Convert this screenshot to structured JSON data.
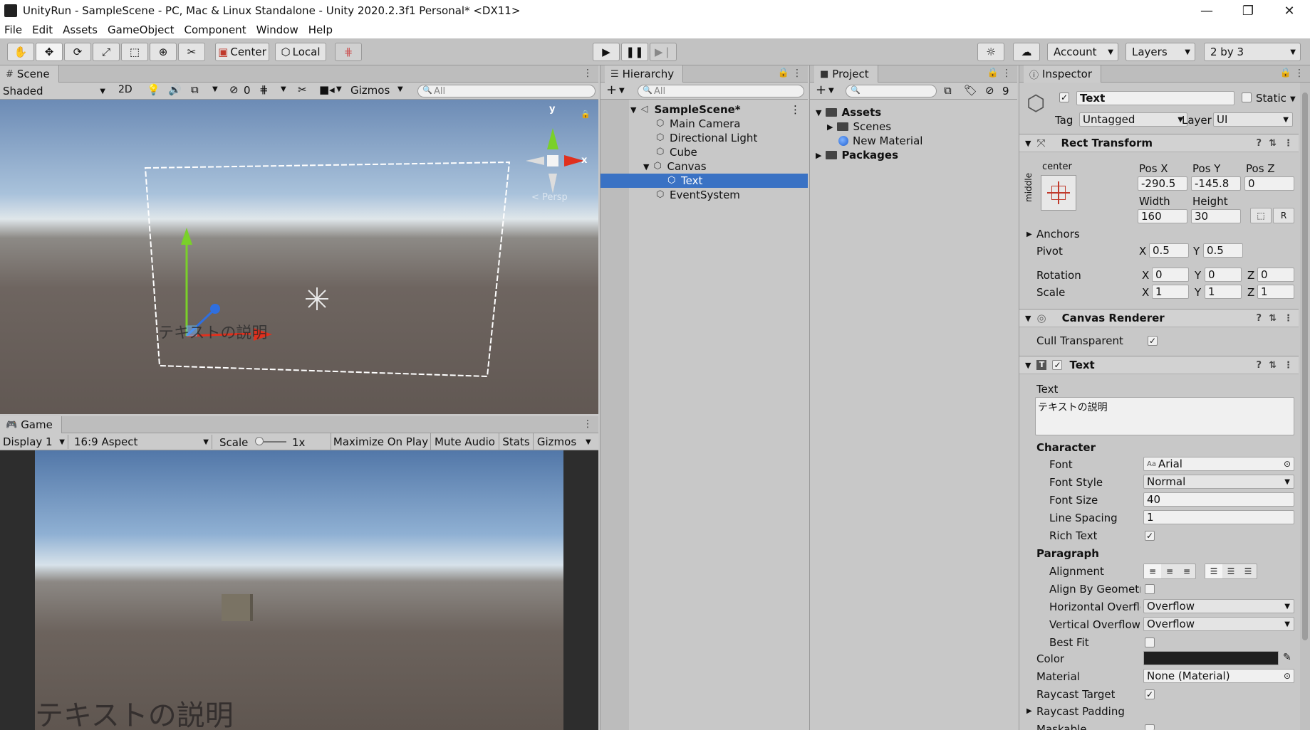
{
  "window": {
    "title": "UnityRun - SampleScene - PC, Mac & Linux Standalone - Unity 2020.2.3f1 Personal* <DX11>",
    "minimize": "—",
    "restore": "❐",
    "close": "✕"
  },
  "menu": [
    "File",
    "Edit",
    "Assets",
    "GameObject",
    "Component",
    "Window",
    "Help"
  ],
  "toolbar": {
    "center_label": "Center",
    "local_label": "Local",
    "account_label": "Account",
    "layers_label": "Layers",
    "layout_label": "2 by 3"
  },
  "scene": {
    "tab_label": "Scene",
    "shading": "Shaded",
    "mode_2d": "2D",
    "hidden_count": "0",
    "gizmos_label": "Gizmos",
    "search_placeholder": "All",
    "overlay_text": "テキストの説明",
    "gizmo_y": "y",
    "gizmo_x": "x",
    "persp_label": "< Persp"
  },
  "game": {
    "tab_label": "Game",
    "display": "Display 1",
    "aspect": "16:9 Aspect",
    "scale_label": "Scale",
    "scale_value": "1x",
    "maximize_label": "Maximize On Play",
    "mute_label": "Mute Audio",
    "stats_label": "Stats",
    "gizmos_label": "Gizmos",
    "overlay_text": "テキストの説明"
  },
  "hierarchy": {
    "tab_label": "Hierarchy",
    "search_placeholder": "All",
    "scene_name": "SampleScene*",
    "items": [
      {
        "label": "Main Camera"
      },
      {
        "label": "Directional Light"
      },
      {
        "label": "Cube"
      },
      {
        "label": "Canvas"
      },
      {
        "label": "Text"
      },
      {
        "label": "EventSystem"
      }
    ]
  },
  "project": {
    "tab_label": "Project",
    "hidden_count": "9",
    "assets_label": "Assets",
    "scenes_label": "Scenes",
    "material_label": "New Material",
    "packages_label": "Packages"
  },
  "inspector": {
    "tab_label": "Inspector",
    "object_name": "Text",
    "static_label": "Static",
    "tag_label": "Tag",
    "tag_value": "Untagged",
    "layer_label": "Layer",
    "layer_value": "UI",
    "rect_transform": {
      "title": "Rect Transform",
      "anchor_h": "center",
      "anchor_v": "middle",
      "pos_x_label": "Pos X",
      "pos_x": "-290.5",
      "pos_y_label": "Pos Y",
      "pos_y": "-145.8",
      "pos_z_label": "Pos Z",
      "pos_z": "0",
      "width_label": "Width",
      "width": "160",
      "height_label": "Height",
      "height": "30",
      "r_label": "R",
      "anchors_label": "Anchors",
      "pivot_label": "Pivot",
      "pivot_x": "0.5",
      "pivot_y": "0.5",
      "rotation_label": "Rotation",
      "rot_x": "0",
      "rot_y": "0",
      "rot_z": "0",
      "scale_label": "Scale",
      "scale_x": "1",
      "scale_y": "1",
      "scale_z": "1",
      "x": "X",
      "y": "Y",
      "z": "Z"
    },
    "canvas_renderer": {
      "title": "Canvas Renderer",
      "cull_label": "Cull Transparent Me"
    },
    "text_comp": {
      "title": "Text",
      "text_label": "Text",
      "text_value": "テキストの説明",
      "character_label": "Character",
      "font_label": "Font",
      "font_value": "Arial",
      "font_style_label": "Font Style",
      "font_style_value": "Normal",
      "font_size_label": "Font Size",
      "font_size_value": "40",
      "line_spacing_label": "Line Spacing",
      "line_spacing_value": "1",
      "rich_text_label": "Rich Text",
      "paragraph_label": "Paragraph",
      "alignment_label": "Alignment",
      "align_geom_label": "Align By Geometry",
      "h_overflow_label": "Horizontal Overflo",
      "h_overflow_value": "Overflow",
      "v_overflow_label": "Vertical Overflow",
      "v_overflow_value": "Overflow",
      "best_fit_label": "Best Fit",
      "color_label": "Color",
      "color_value": "#1f1f1f",
      "material_label": "Material",
      "material_value": "None (Material)",
      "raycast_label": "Raycast Target",
      "raycast_padding_label": "Raycast Padding",
      "maskable_label": "Maskable"
    }
  },
  "colors": {
    "selection": "#3a72c4",
    "panel_bg": "#c8c8c8",
    "gizmo_x": "#e0301e",
    "gizmo_y": "#7ad02a",
    "gizmo_z": "#2f6fe0"
  }
}
